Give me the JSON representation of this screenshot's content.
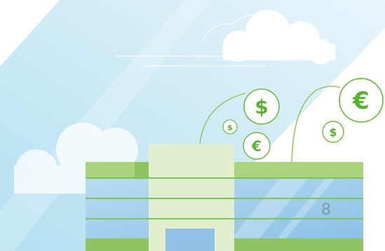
{
  "colors": {
    "sky_start": "#e6f4fb",
    "sky_end": "#a6dcef",
    "cloud": "#ffffff",
    "building_green": "#7cc35b",
    "building_green_light": "#a8d47a",
    "tower_face": "#e3efcf",
    "glass": "#a9d3ef",
    "glass_dark": "#8fc2e6",
    "coin_stroke": "#6dbb3f",
    "coin_text": "#5bb030",
    "stem": "#8bc34a",
    "window_digit": "#7f9ab0"
  },
  "icons": [
    "dollar-coin-icon",
    "euro-coin-icon"
  ],
  "coins": {
    "dollar_large": "$",
    "dollar_small": "$",
    "dollar_right": "$",
    "euro_large": "€",
    "euro_small": "€"
  },
  "building": {
    "window_number": "8"
  }
}
